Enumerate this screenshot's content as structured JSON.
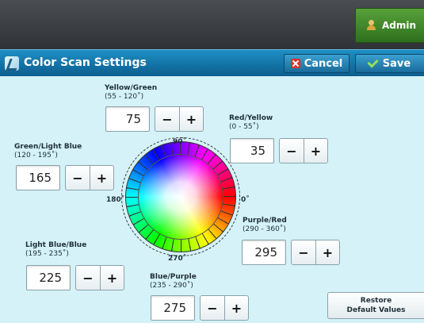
{
  "header": {
    "admin_label": "Admin"
  },
  "titlebar": {
    "title": "Color Scan Settings",
    "cancel_label": "Cancel",
    "save_label": "Save"
  },
  "controls": {
    "yellow_green": {
      "label": "Yellow/Green",
      "range": "(55 - 120˚)",
      "value": "75"
    },
    "red_yellow": {
      "label": "Red/Yellow",
      "range": "(0 - 55˚)",
      "value": "35"
    },
    "green_lightblue": {
      "label": "Green/Light Blue",
      "range": "(120 - 195˚)",
      "value": "165"
    },
    "purple_red": {
      "label": "Purple/Red",
      "range": "(290 - 360˚)",
      "value": "295"
    },
    "lightblue_blue": {
      "label": "Light Blue/Blue",
      "range": "(195 - 235˚)",
      "value": "225"
    },
    "blue_purple": {
      "label": "Blue/Purple",
      "range": "(235 - 290˚)",
      "value": "275"
    }
  },
  "stepper": {
    "minus": "−",
    "plus": "+"
  },
  "wheel": {
    "deg_90": "90˚",
    "deg_180": "180˚",
    "deg_0": "0˚",
    "deg_270": "270˚"
  },
  "restore": {
    "line1": "Restore",
    "line2": "Default Values"
  }
}
